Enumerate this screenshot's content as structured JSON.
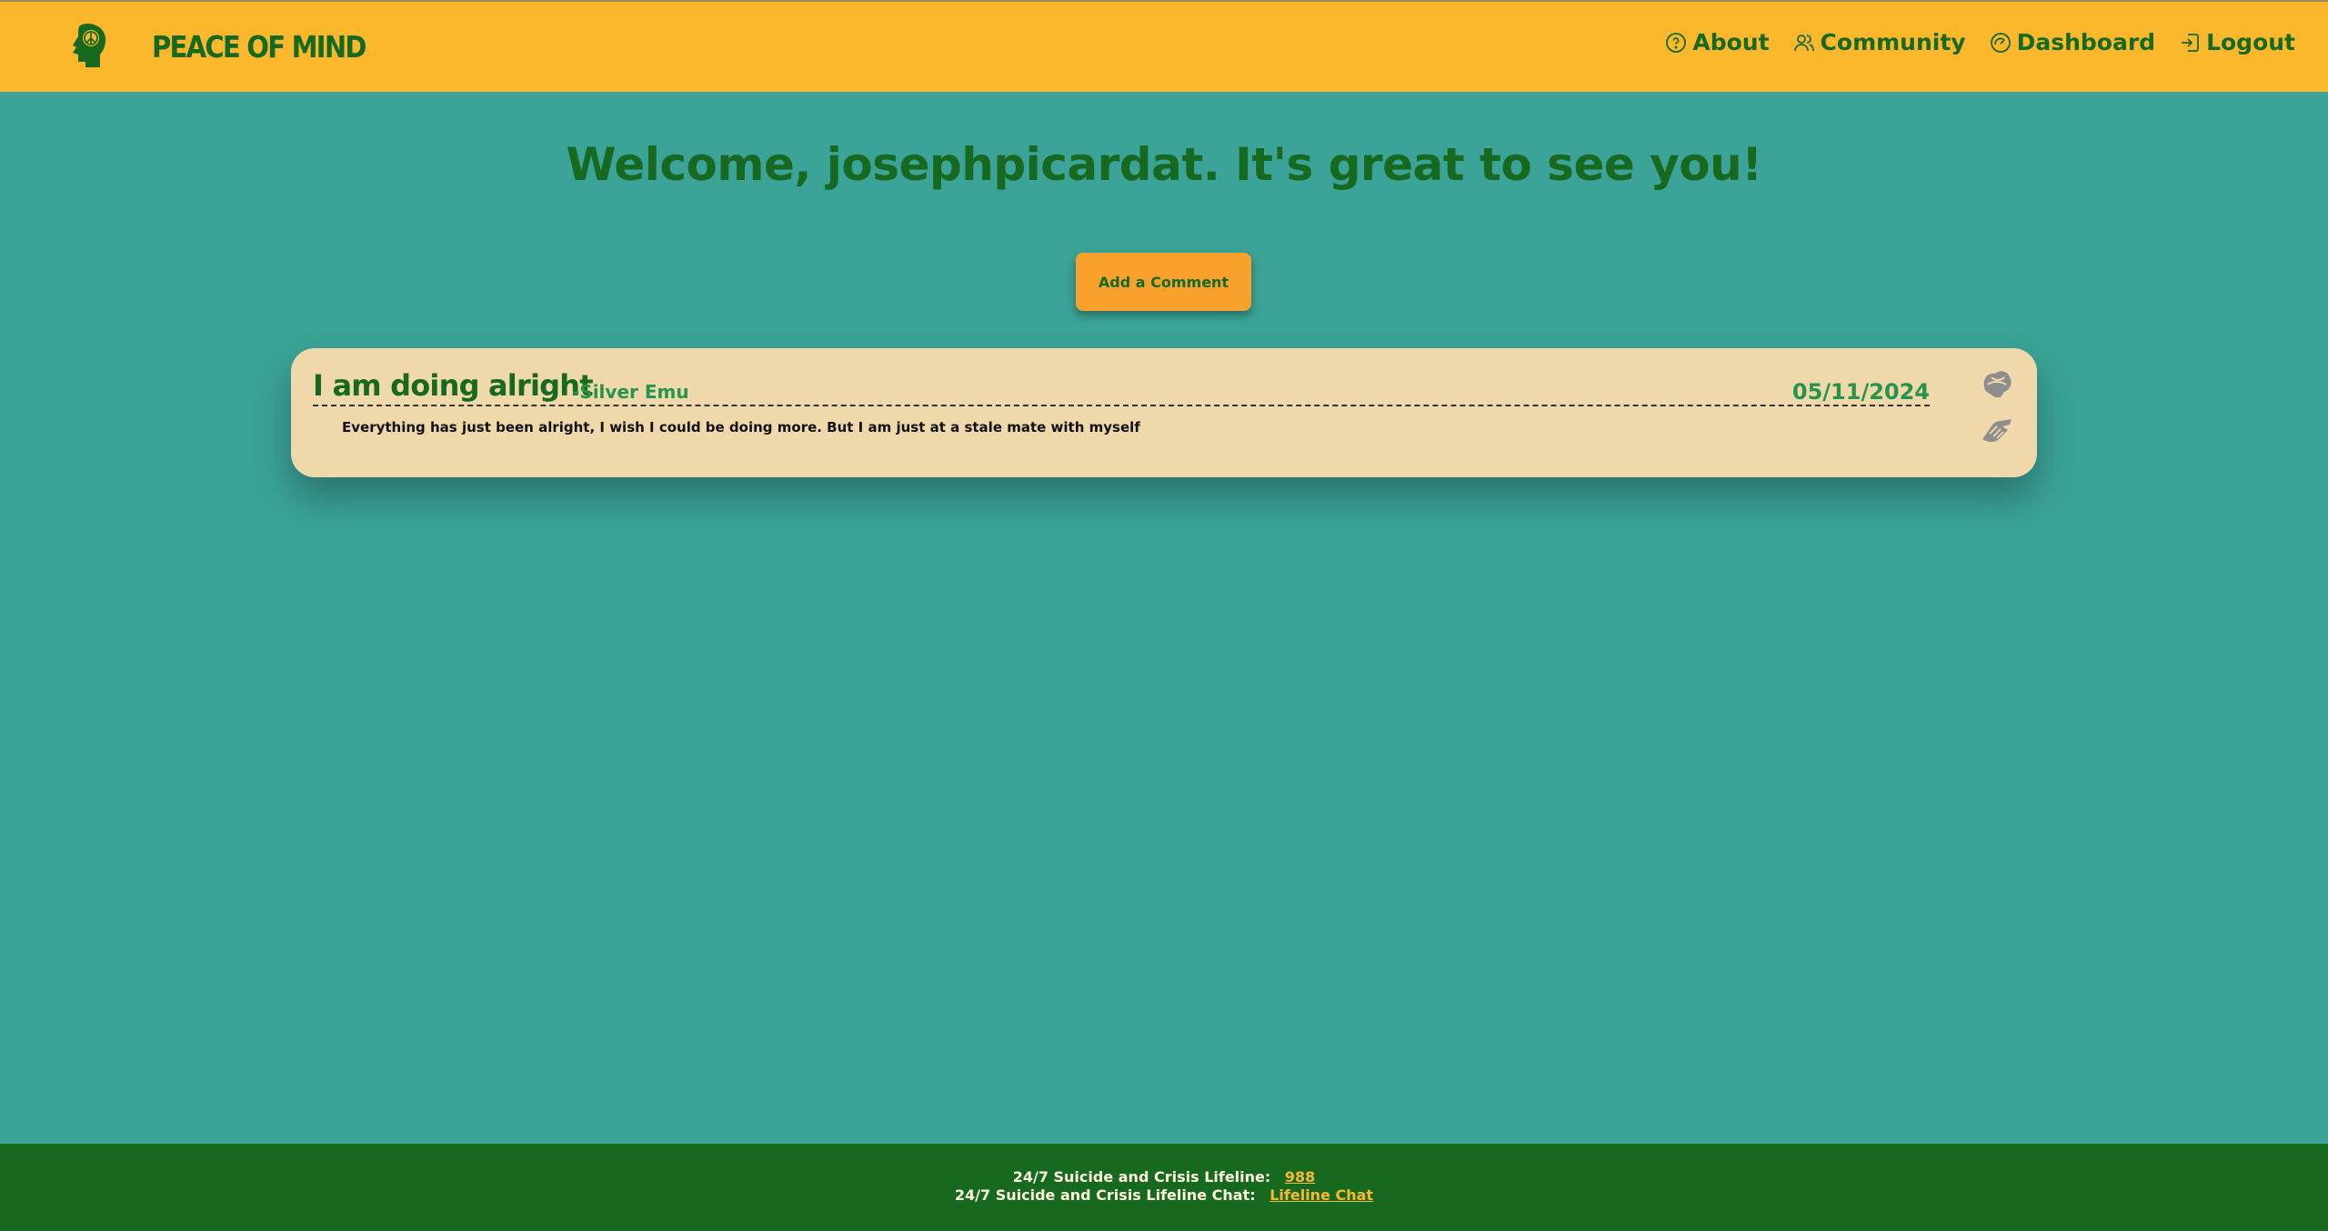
{
  "brand": {
    "name": "PEACE OF MIND",
    "logo_icon": "head-peace-icon"
  },
  "nav": [
    {
      "label": "About",
      "icon": "question-circle-icon"
    },
    {
      "label": "Community",
      "icon": "users-icon"
    },
    {
      "label": "Dashboard",
      "icon": "gauge-icon"
    },
    {
      "label": "Logout",
      "icon": "logout-icon"
    }
  ],
  "welcome": "Welcome, josephpicardat. It's great to see you!",
  "add_comment_label": "Add a Comment",
  "post": {
    "title": "I am doing alright",
    "author": "-Silver Emu",
    "date": "05/11/2024",
    "body": "Everything has just been alright, I wish I could be doing more. But I am just at a stale mate with myself",
    "reactions": [
      "hug-icon",
      "clap-hands-icon"
    ]
  },
  "footer": {
    "line1_label": "24/7 Suicide and Crisis Lifeline:",
    "line1_link": "988",
    "line2_label": "24/7 Suicide and Crisis Lifeline Chat:",
    "line2_link": "Lifeline Chat"
  },
  "colors": {
    "header_bg": "#fbb82c",
    "page_bg": "#3ba397",
    "brand_green": "#17691f",
    "card_bg": "#efd9aa",
    "button_orange": "#f8a12c",
    "footer_bg": "#17691f"
  }
}
